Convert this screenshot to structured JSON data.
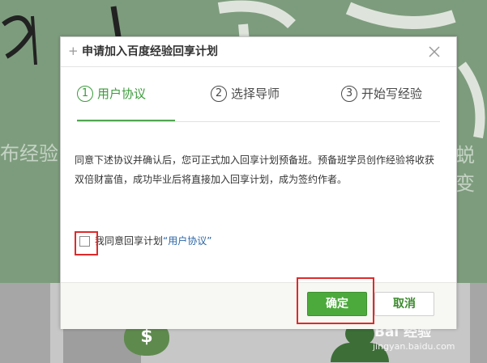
{
  "dialog": {
    "title": "申请加入百度经验回享计划",
    "close_icon": "close-icon"
  },
  "steps": [
    {
      "number": "1",
      "label": "用户协议",
      "active": true
    },
    {
      "number": "2",
      "label": "选择导师",
      "active": false
    },
    {
      "number": "3",
      "label": "开始写经验",
      "active": false
    }
  ],
  "description": "同意下述协议并确认后，您可正式加入回享计划预备班。预备班学员创作经验将收获双倍财富值，成功毕业后将直接加入回享计划，成为签约作者。",
  "agreement": {
    "checked": false,
    "prefix": "我同意回享计划",
    "link_text": "“用户协议”"
  },
  "buttons": {
    "ok": "确定",
    "cancel": "取消"
  },
  "background": {
    "text_left": "布经验",
    "text_right": "蜕变",
    "watermark": "Bai 经验",
    "watermark_sub": "jingyan.baidu.com"
  },
  "colors": {
    "accent": "#4caa3c",
    "highlight": "#e0292b",
    "link": "#2b66a6",
    "background": "#7d9c7d"
  }
}
